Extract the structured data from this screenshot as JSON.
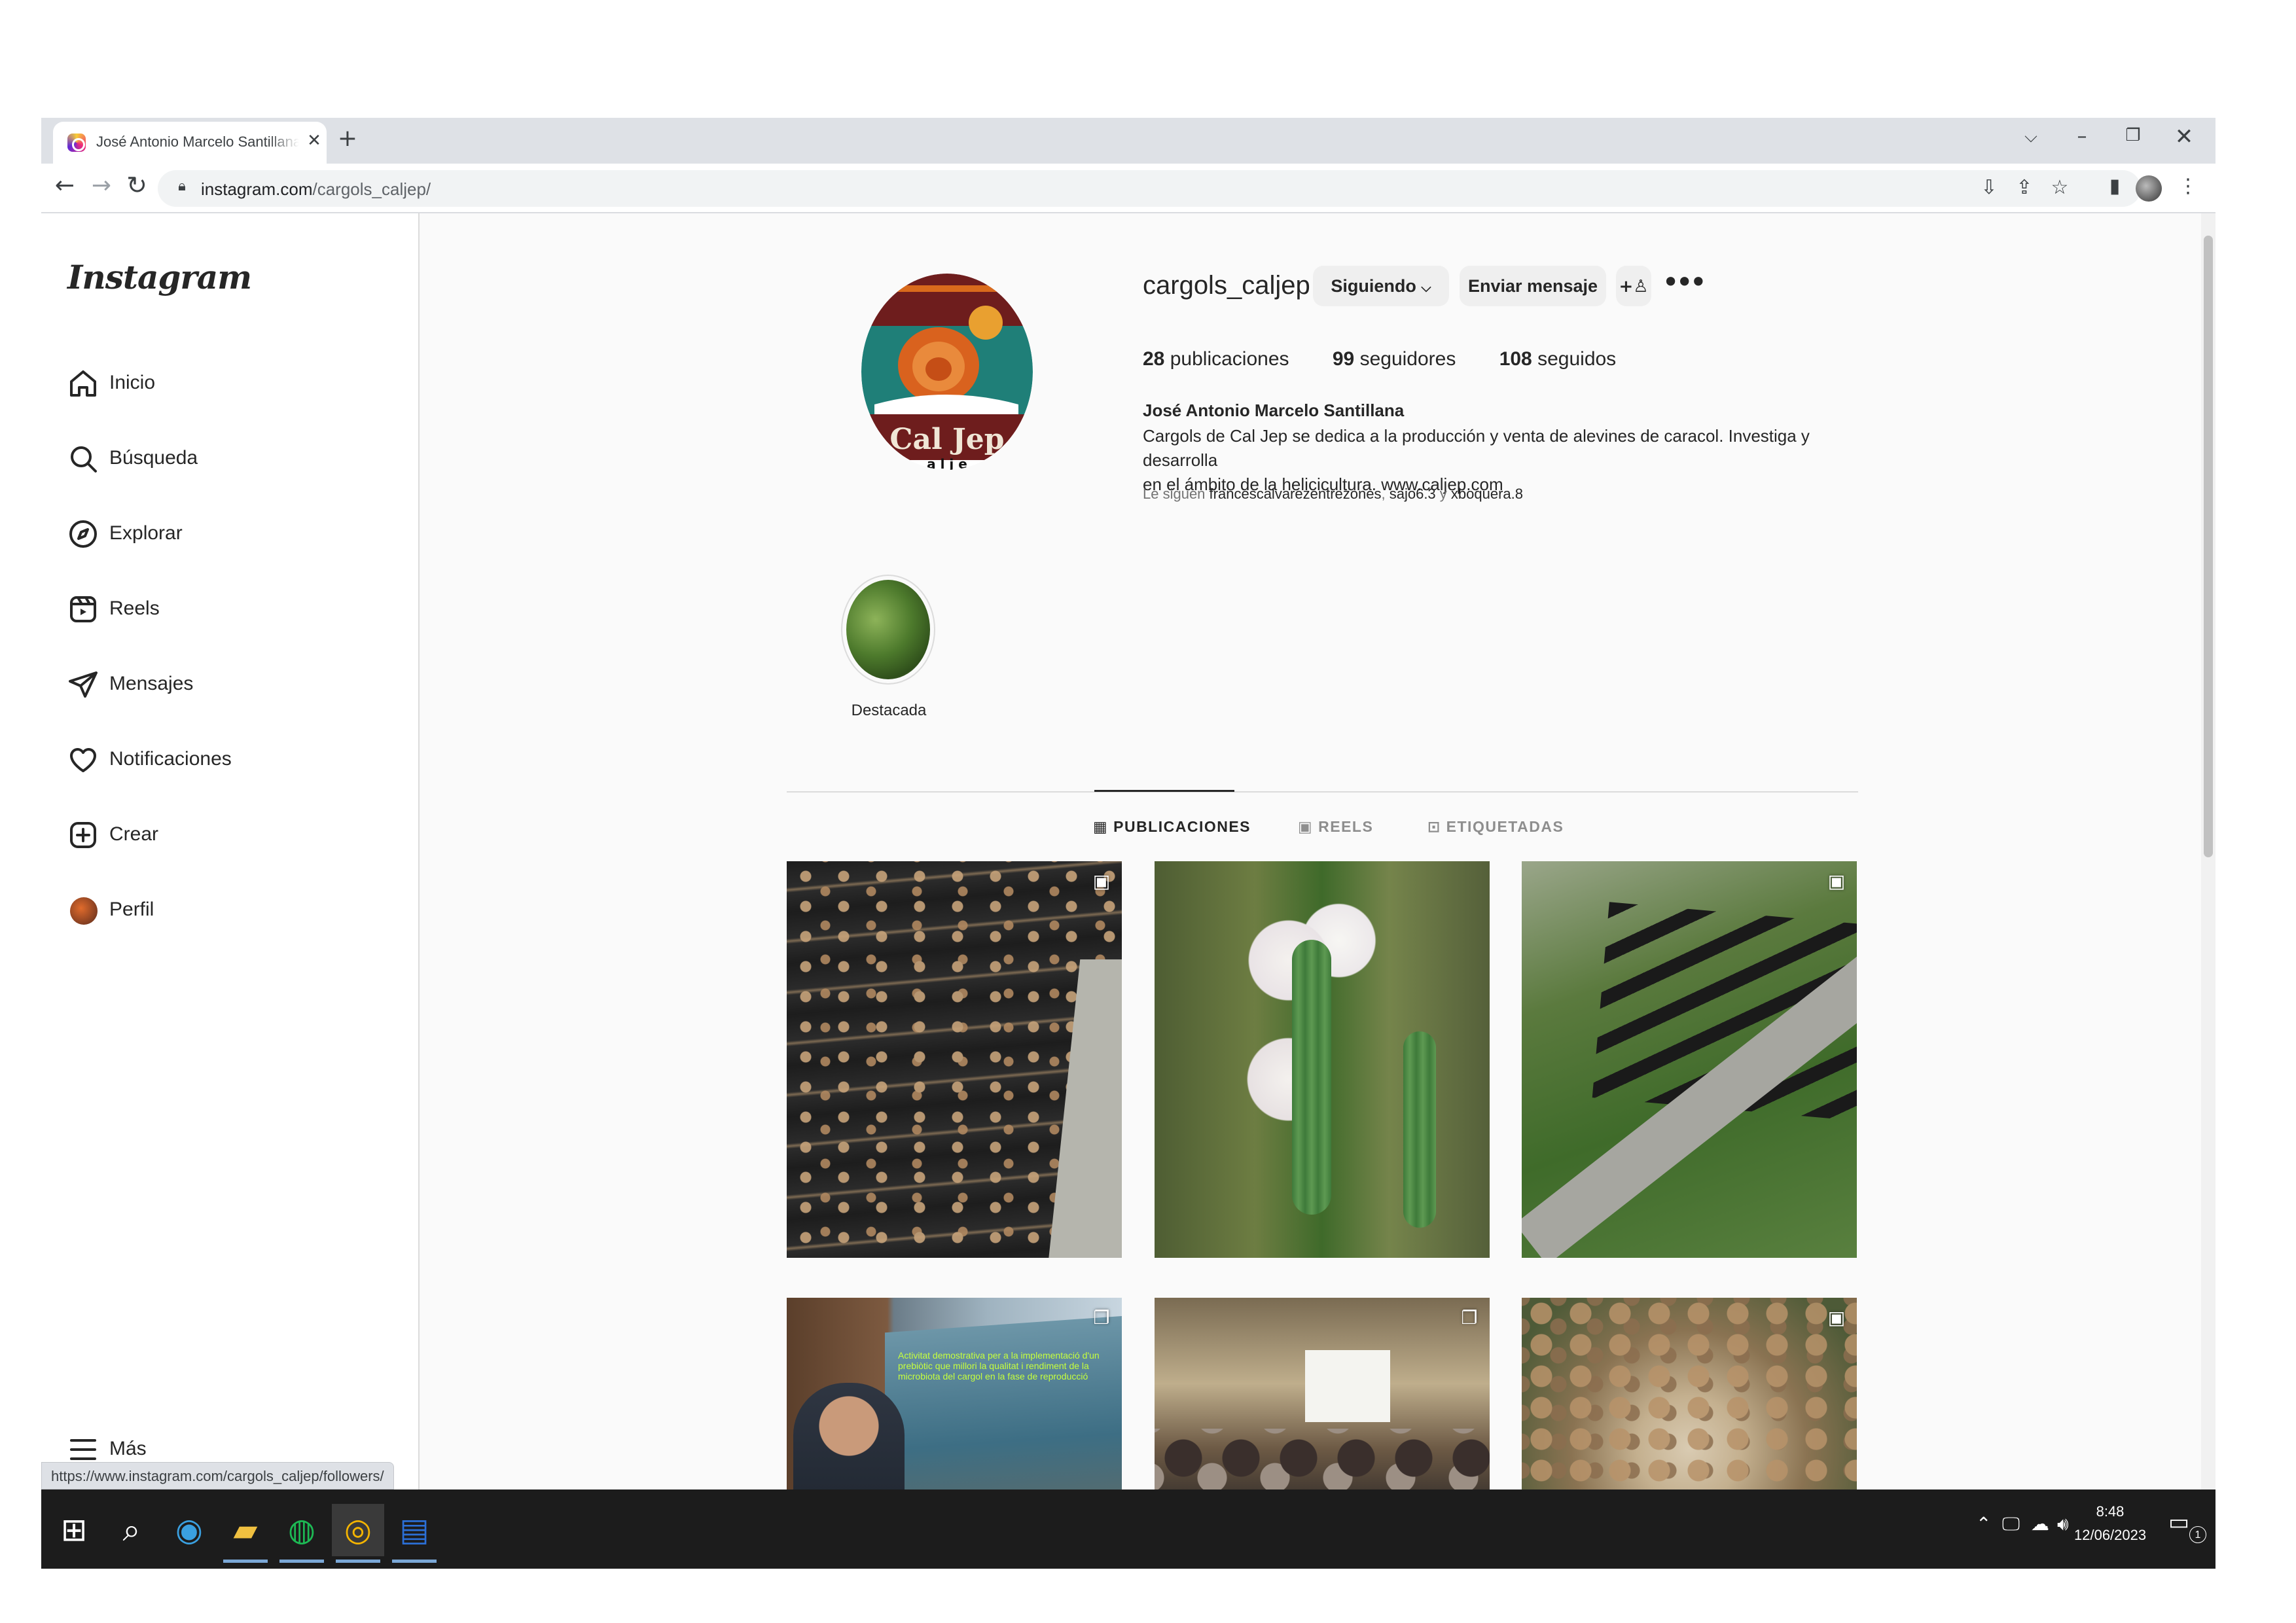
{
  "browser": {
    "tab_title": "José Antonio Marcelo Santillana (@cargols_caljep)",
    "url_domain": "instagram.com",
    "url_path": "/cargols_caljep/",
    "status_url": "https://www.instagram.com/cargols_caljep/followers/"
  },
  "sidebar": {
    "logo": "Instagram",
    "items": [
      {
        "label": "Inicio",
        "icon": "home-icon"
      },
      {
        "label": "Búsqueda",
        "icon": "search-icon"
      },
      {
        "label": "Explorar",
        "icon": "compass-icon"
      },
      {
        "label": "Reels",
        "icon": "reels-icon"
      },
      {
        "label": "Mensajes",
        "icon": "send-icon"
      },
      {
        "label": "Notificaciones",
        "icon": "heart-icon"
      },
      {
        "label": "Crear",
        "icon": "plus-square-icon"
      },
      {
        "label": "Perfil",
        "icon": "profile-avatar"
      }
    ],
    "more_label": "Más"
  },
  "profile": {
    "username": "cargols_caljep",
    "following_button": "Siguiendo",
    "message_button": "Enviar mensaje",
    "stats": {
      "posts_count": "28",
      "posts_label": "publicaciones",
      "followers_count": "99",
      "followers_label": "seguidores",
      "following_count": "108",
      "following_label": "seguidos"
    },
    "full_name": "José Antonio Marcelo Santillana",
    "bio_line1": "Cargols de Cal Jep se dedica a la producción y venta de alevines de caracol. Investiga y desarrolla",
    "bio_line2": "en el ámbito de la helicicultura. www.caljep.com",
    "followed_by_prefix": "Le siguen",
    "followed_by_1": "francescalvarezentrezones",
    "followed_by_sep": ",",
    "followed_by_2": "sajo6.3",
    "followed_by_and": "y",
    "followed_by_3": "xboquera.8",
    "logo_text": "Cal Jep",
    "logo_subtext": "a l j e",
    "highlight_label": "Destacada"
  },
  "tabs": {
    "posts": "PUBLICACIONES",
    "reels": "REELS",
    "tagged": "ETIQUETADAS"
  },
  "posts": [
    {
      "type": "reel",
      "badge": "reels-icon"
    },
    {
      "type": "image",
      "badge": ""
    },
    {
      "type": "reel",
      "badge": "reels-icon"
    },
    {
      "type": "carousel",
      "badge": "carousel-icon",
      "overlay_text": "Activitat demostrativa per a la implementació d'un prebiòtic que millori la qualitat i rendiment de la microbiota del cargol en la fase de reproducció"
    },
    {
      "type": "carousel",
      "badge": "carousel-icon"
    },
    {
      "type": "reel",
      "badge": "reels-icon"
    }
  ],
  "taskbar": {
    "time": "8:48",
    "date": "12/06/2023",
    "notification_count": "1"
  },
  "colors": {
    "accent_text": "#262626",
    "secondary_text": "#737373",
    "button_bg": "#efefef",
    "divider": "#dbdbdb"
  }
}
